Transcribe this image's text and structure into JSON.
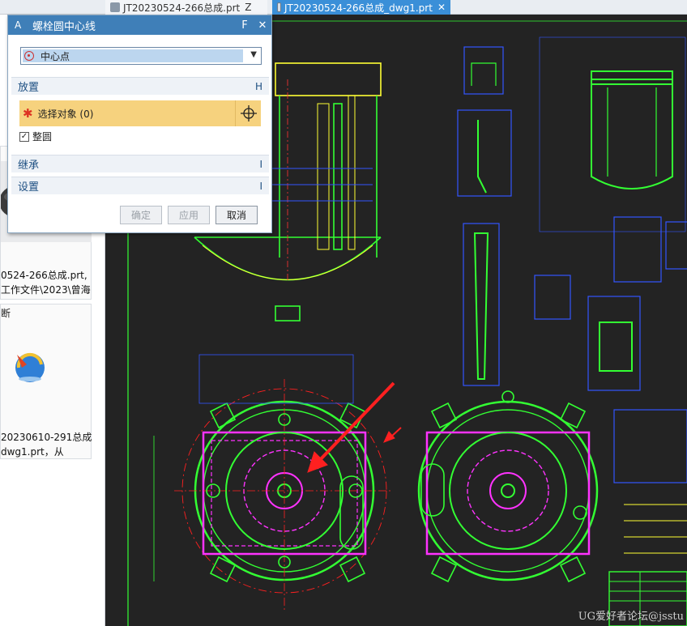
{
  "tabs": [
    {
      "label": "JT20230524-266总成.prt",
      "suffix": "Z",
      "active": false
    },
    {
      "label": "JT20230524-266总成_dwg1.prt",
      "close": "✕",
      "active": true
    }
  ],
  "side_panel": {
    "fragment_1": "断",
    "fragment_2": "断",
    "recent_files": [
      {
        "line1": "0524-266总成.prt,",
        "line2": "工作文件\\2023\\曾海"
      },
      {
        "line1": "20230610-291总成",
        "line2": "dwg1.prt，从"
      }
    ]
  },
  "dialog": {
    "app_letter": "A",
    "title": "螺栓圆中心线",
    "header_f": "F",
    "close": "✕",
    "type_select": {
      "value": "中心点"
    },
    "placement": {
      "label": "放置",
      "end_label": "H",
      "select_object": "选择对象 (0)",
      "full_circle": {
        "label": "整圆",
        "checked": true
      }
    },
    "inherit": {
      "label": "继承",
      "end_label": "I"
    },
    "settings": {
      "label": "设置",
      "end_label": "I"
    },
    "buttons": {
      "ok": "确定",
      "apply": "应用",
      "cancel": "取消"
    }
  },
  "drawing": {
    "watermark": "UG爱好者论坛@jsstu"
  },
  "colors": {
    "title_bar": "#3f7fb8",
    "active_tab": "#3a8fd8",
    "required_highlight": "#f6d27e",
    "canvas_bg": "#232323",
    "cad_green": "#33ff33",
    "cad_magenta": "#ff33ff",
    "cad_red": "#ff2020",
    "cad_blue": "#3355ff",
    "cad_yellow": "#ffff33"
  },
  "icons": {
    "crosshair": "crosshair-icon",
    "center_point": "center-point-icon",
    "required": "required-star-icon"
  }
}
